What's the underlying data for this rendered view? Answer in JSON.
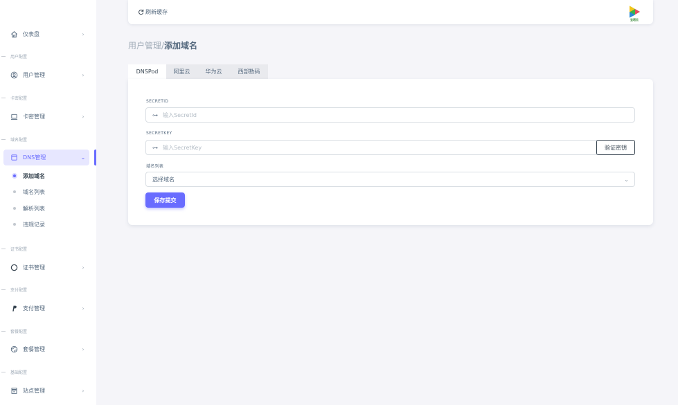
{
  "sidebar": {
    "items": [
      {
        "label": "仪表盘",
        "icon": "home-icon"
      },
      {
        "label": "用户管理",
        "icon": "user-circle-icon"
      },
      {
        "label": "卡密管理",
        "icon": "laptop-icon"
      },
      {
        "label": "DNS管理",
        "icon": "calendar-icon"
      },
      {
        "label": "证书管理",
        "icon": "circle-icon"
      },
      {
        "label": "支付管理",
        "icon": "paypal-icon"
      },
      {
        "label": "套餐管理",
        "icon": "globe-icon"
      },
      {
        "label": "站点管理",
        "icon": "store-icon"
      }
    ],
    "headers": [
      "用户配置",
      "卡密配置",
      "域名配置",
      "证书配置",
      "支付配置",
      "套餐配置",
      "基础配置"
    ],
    "sub_items": [
      "添加域名",
      "域名列表",
      "解析列表",
      "违规记录"
    ],
    "active_item": "DNS管理",
    "active_sub_item": "添加域名"
  },
  "topbar": {
    "refresh_label": "刷新缓存",
    "logo_text": "宝塔云",
    "refresh_icon": "refresh-icon",
    "logo_icon": "play-logo-icon"
  },
  "breadcrumb": {
    "parent": "用户管理/",
    "current": "添加域名"
  },
  "tabs": [
    "DNSPod",
    "阿里云",
    "华为云",
    "西部数码"
  ],
  "active_tab": "DNSPod",
  "form": {
    "secret_id_label": "SECRETID",
    "secret_id_placeholder": "输入SecretId",
    "secret_key_label": "SECRETKEY",
    "secret_key_placeholder": "输入SecretKey",
    "verify_label": "验证密钥",
    "domain_list_label": "域名列表",
    "domain_select_value": "选择域名",
    "submit_label": "保存提交"
  },
  "colors": {
    "accent": "#696cff",
    "accent_light": "#e7e7ff",
    "background": "#f5f5f9",
    "text": "#566a7f"
  }
}
